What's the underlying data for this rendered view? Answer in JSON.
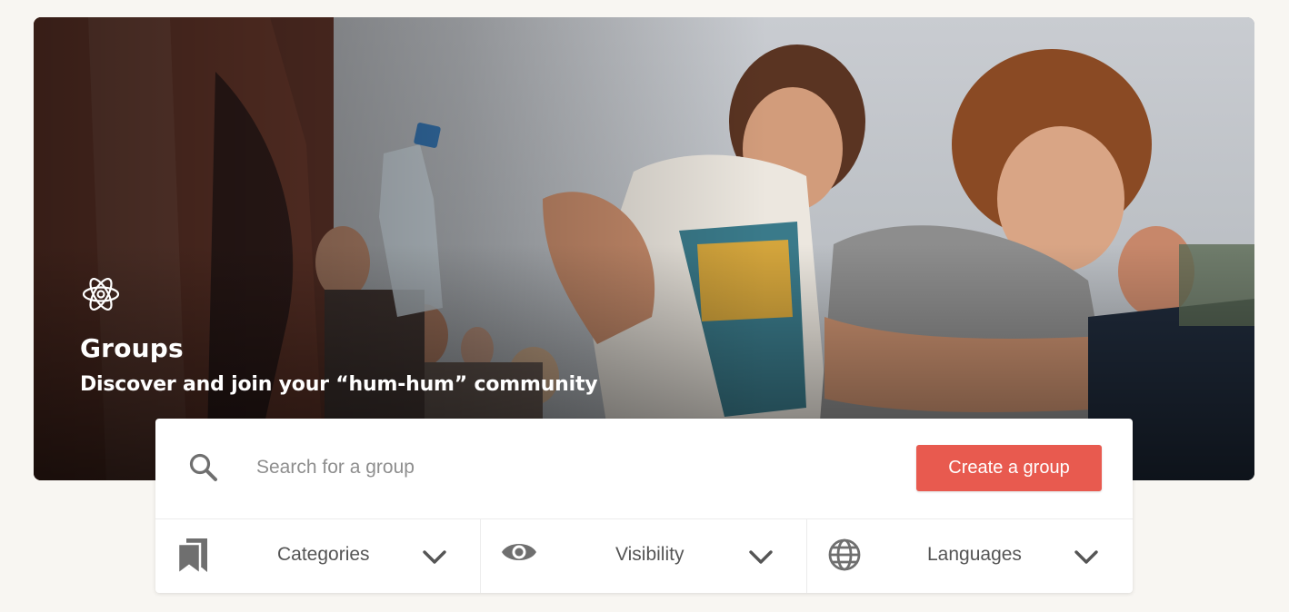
{
  "hero": {
    "title": "Groups",
    "subtitle": "Discover and join your “hum-hum” community",
    "icon": "atom-icon"
  },
  "search": {
    "placeholder": "Search for a group",
    "value": "",
    "icon": "search-icon"
  },
  "actions": {
    "create_label": "Create a group"
  },
  "filters": [
    {
      "label": "Categories",
      "icon": "bookmarks-icon"
    },
    {
      "label": "Visibility",
      "icon": "eye-icon"
    },
    {
      "label": "Languages",
      "icon": "globe-icon"
    }
  ],
  "colors": {
    "accent": "#e85a4f",
    "page_background": "#f8f6f2",
    "icon_gray": "#6f6f6f",
    "text_gray": "#555555"
  }
}
